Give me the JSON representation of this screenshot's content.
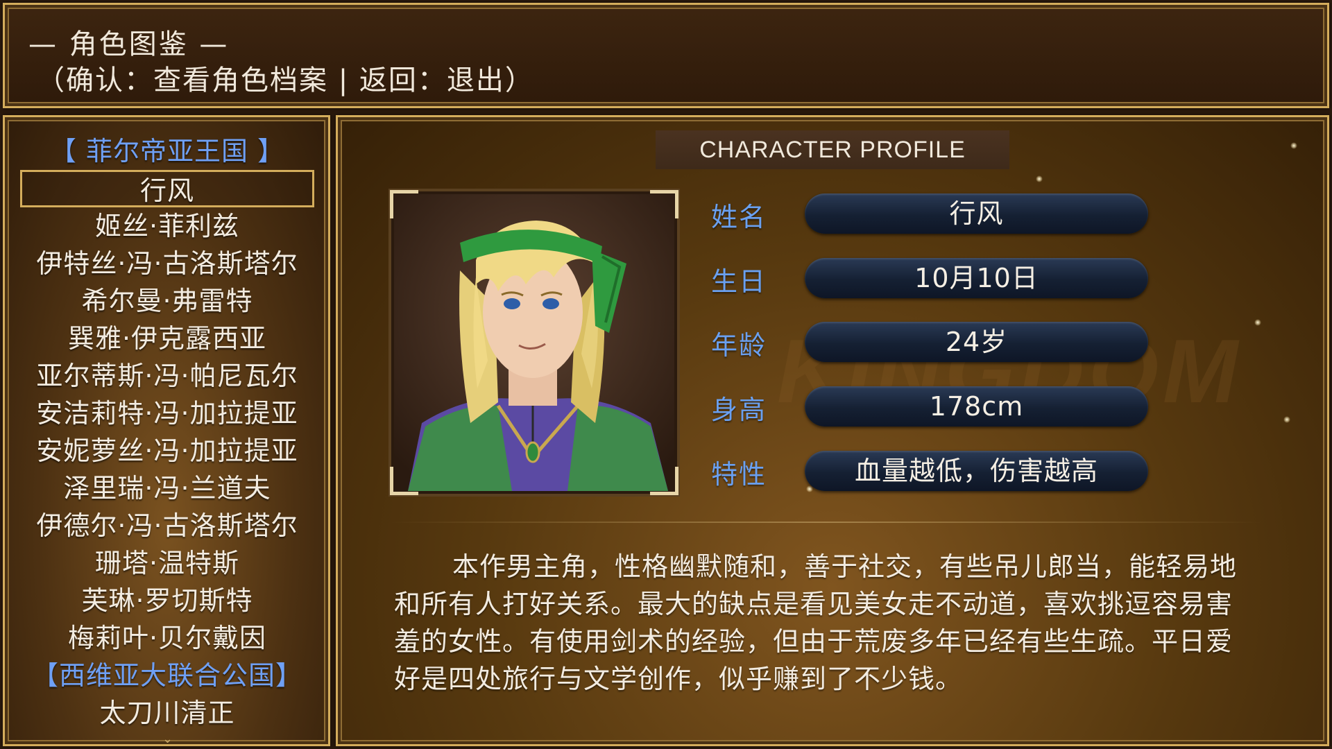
{
  "header": {
    "title": "— 角色图鉴 —",
    "hint": "（确认：查看角色档案 | 返回：退出）"
  },
  "character_list": {
    "items": [
      {
        "label": "【 菲尔帝亚王国 】",
        "type": "group"
      },
      {
        "label": "行风",
        "type": "selected"
      },
      {
        "label": "姬丝·菲利兹",
        "type": "item"
      },
      {
        "label": "伊特丝·冯·古洛斯塔尔",
        "type": "item"
      },
      {
        "label": "希尔曼·弗雷特",
        "type": "item"
      },
      {
        "label": "巽雅·伊克露西亚",
        "type": "item"
      },
      {
        "label": "亚尔蒂斯·冯·帕尼瓦尔",
        "type": "item"
      },
      {
        "label": "安洁莉特·冯·加拉提亚",
        "type": "item"
      },
      {
        "label": "安妮萝丝·冯·加拉提亚",
        "type": "item"
      },
      {
        "label": "泽里瑞·冯·兰道夫",
        "type": "item"
      },
      {
        "label": "伊德尔·冯·古洛斯塔尔",
        "type": "item"
      },
      {
        "label": "珊塔·温特斯",
        "type": "item"
      },
      {
        "label": "芙琳·罗切斯特",
        "type": "item"
      },
      {
        "label": "梅莉叶·贝尔戴因",
        "type": "item"
      },
      {
        "label": "【西维亚大联合公国】",
        "type": "group"
      },
      {
        "label": "太刀川清正",
        "type": "item"
      }
    ],
    "more_icon": "chevron-down-icon"
  },
  "profile": {
    "tab_label": "CHARACTER PROFILE",
    "watermark": "KINGDOM",
    "fields": [
      {
        "label": "姓名",
        "value": "行风"
      },
      {
        "label": "生日",
        "value": "10月10日"
      },
      {
        "label": "年龄",
        "value": "24岁"
      },
      {
        "label": "身高",
        "value": "178cm"
      },
      {
        "label": "特性",
        "value": "血量越低，伤害越高"
      }
    ],
    "description": "本作男主角，性格幽默随和，善于社交，有些吊儿郎当，能轻易地和所有人打好关系。最大的缺点是看见美女走不动道，喜欢挑逗容易害羞的女性。有使用剑术的经验，但由于荒废多年已经有些生疏。平日爱好是四处旅行与文学创作，似乎赚到了不少钱。"
  },
  "colors": {
    "frame_gold": "#d4ad5c",
    "group_blue": "#6fa0f5",
    "label_blue": "#6aa0f0",
    "pill_navy": "#152033"
  }
}
